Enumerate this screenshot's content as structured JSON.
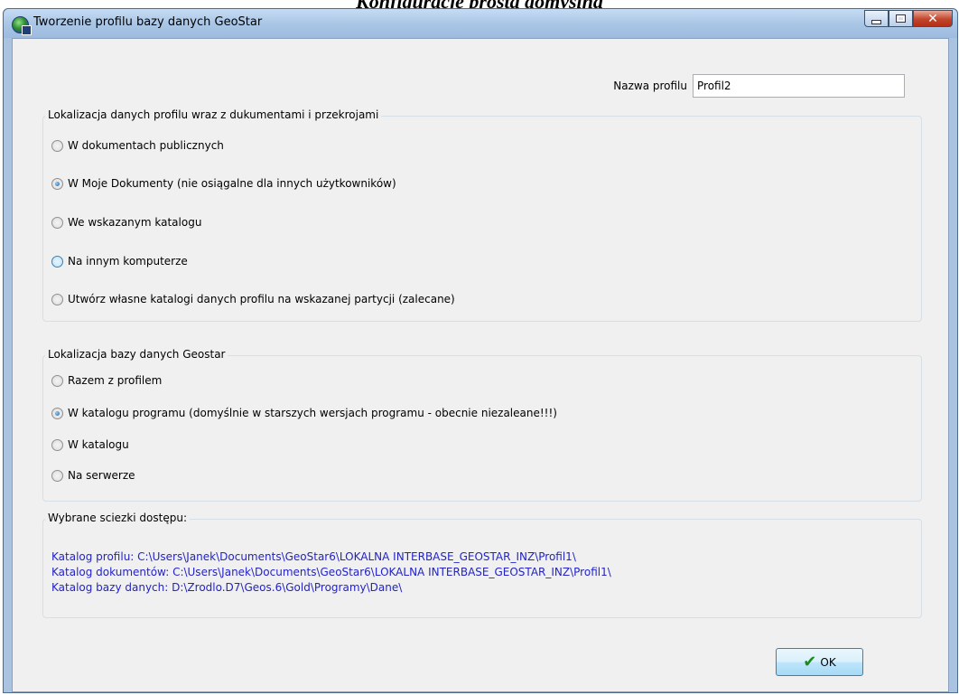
{
  "doc_heading": "Konfiguracje prosta domyślna",
  "window": {
    "title": "Tworzenie profilu bazy danych GeoStar"
  },
  "profile_name": {
    "label": "Nazwa profilu",
    "value": "Profil2"
  },
  "data_location": {
    "title": "Lokalizacja danych profilu wraz z dukumentami i przekrojami",
    "options": [
      {
        "label": "W dokumentach publicznych",
        "checked": false
      },
      {
        "label": "W Moje Dokumenty (nie osiągalne dla innych użytkowników)",
        "checked": true
      },
      {
        "label": "We wskazanym katalogu",
        "checked": false
      },
      {
        "label": "Na innym komputerze",
        "checked": false
      },
      {
        "label": "Utwórz własne katalogi danych profilu na wskazanej partycji  (zalecane)",
        "checked": false
      }
    ]
  },
  "db_location": {
    "title": "Lokalizacja bazy danych Geostar",
    "options": [
      {
        "label": "Razem z profilem",
        "checked": false
      },
      {
        "label": "W katalogu programu (domyślnie w starszych wersjach programu - obecnie niezaleane!!!)",
        "checked": true
      },
      {
        "label": "W katalogu",
        "checked": false
      },
      {
        "label": "Na serwerze",
        "checked": false
      }
    ]
  },
  "paths": {
    "title": "Wybrane sciezki dostępu:",
    "lines": [
      "Katalog profilu: C:\\Users\\Janek\\Documents\\GeoStar6\\LOKALNA INTERBASE_GEOSTAR_INZ\\Profil1\\",
      "Katalog dokumentów: C:\\Users\\Janek\\Documents\\GeoStar6\\LOKALNA INTERBASE_GEOSTAR_INZ\\Profil1\\",
      "Katalog bazy danych: D:\\Zrodlo.D7\\Geos.6\\Gold\\Programy\\Dane\\"
    ]
  },
  "ok_button": {
    "label": "OK"
  },
  "icons": {
    "app": "globe-app-icon",
    "ok": "checkmark-icon",
    "minimize": "minimize-icon",
    "maximize": "maximize-icon",
    "close": "close-icon"
  }
}
